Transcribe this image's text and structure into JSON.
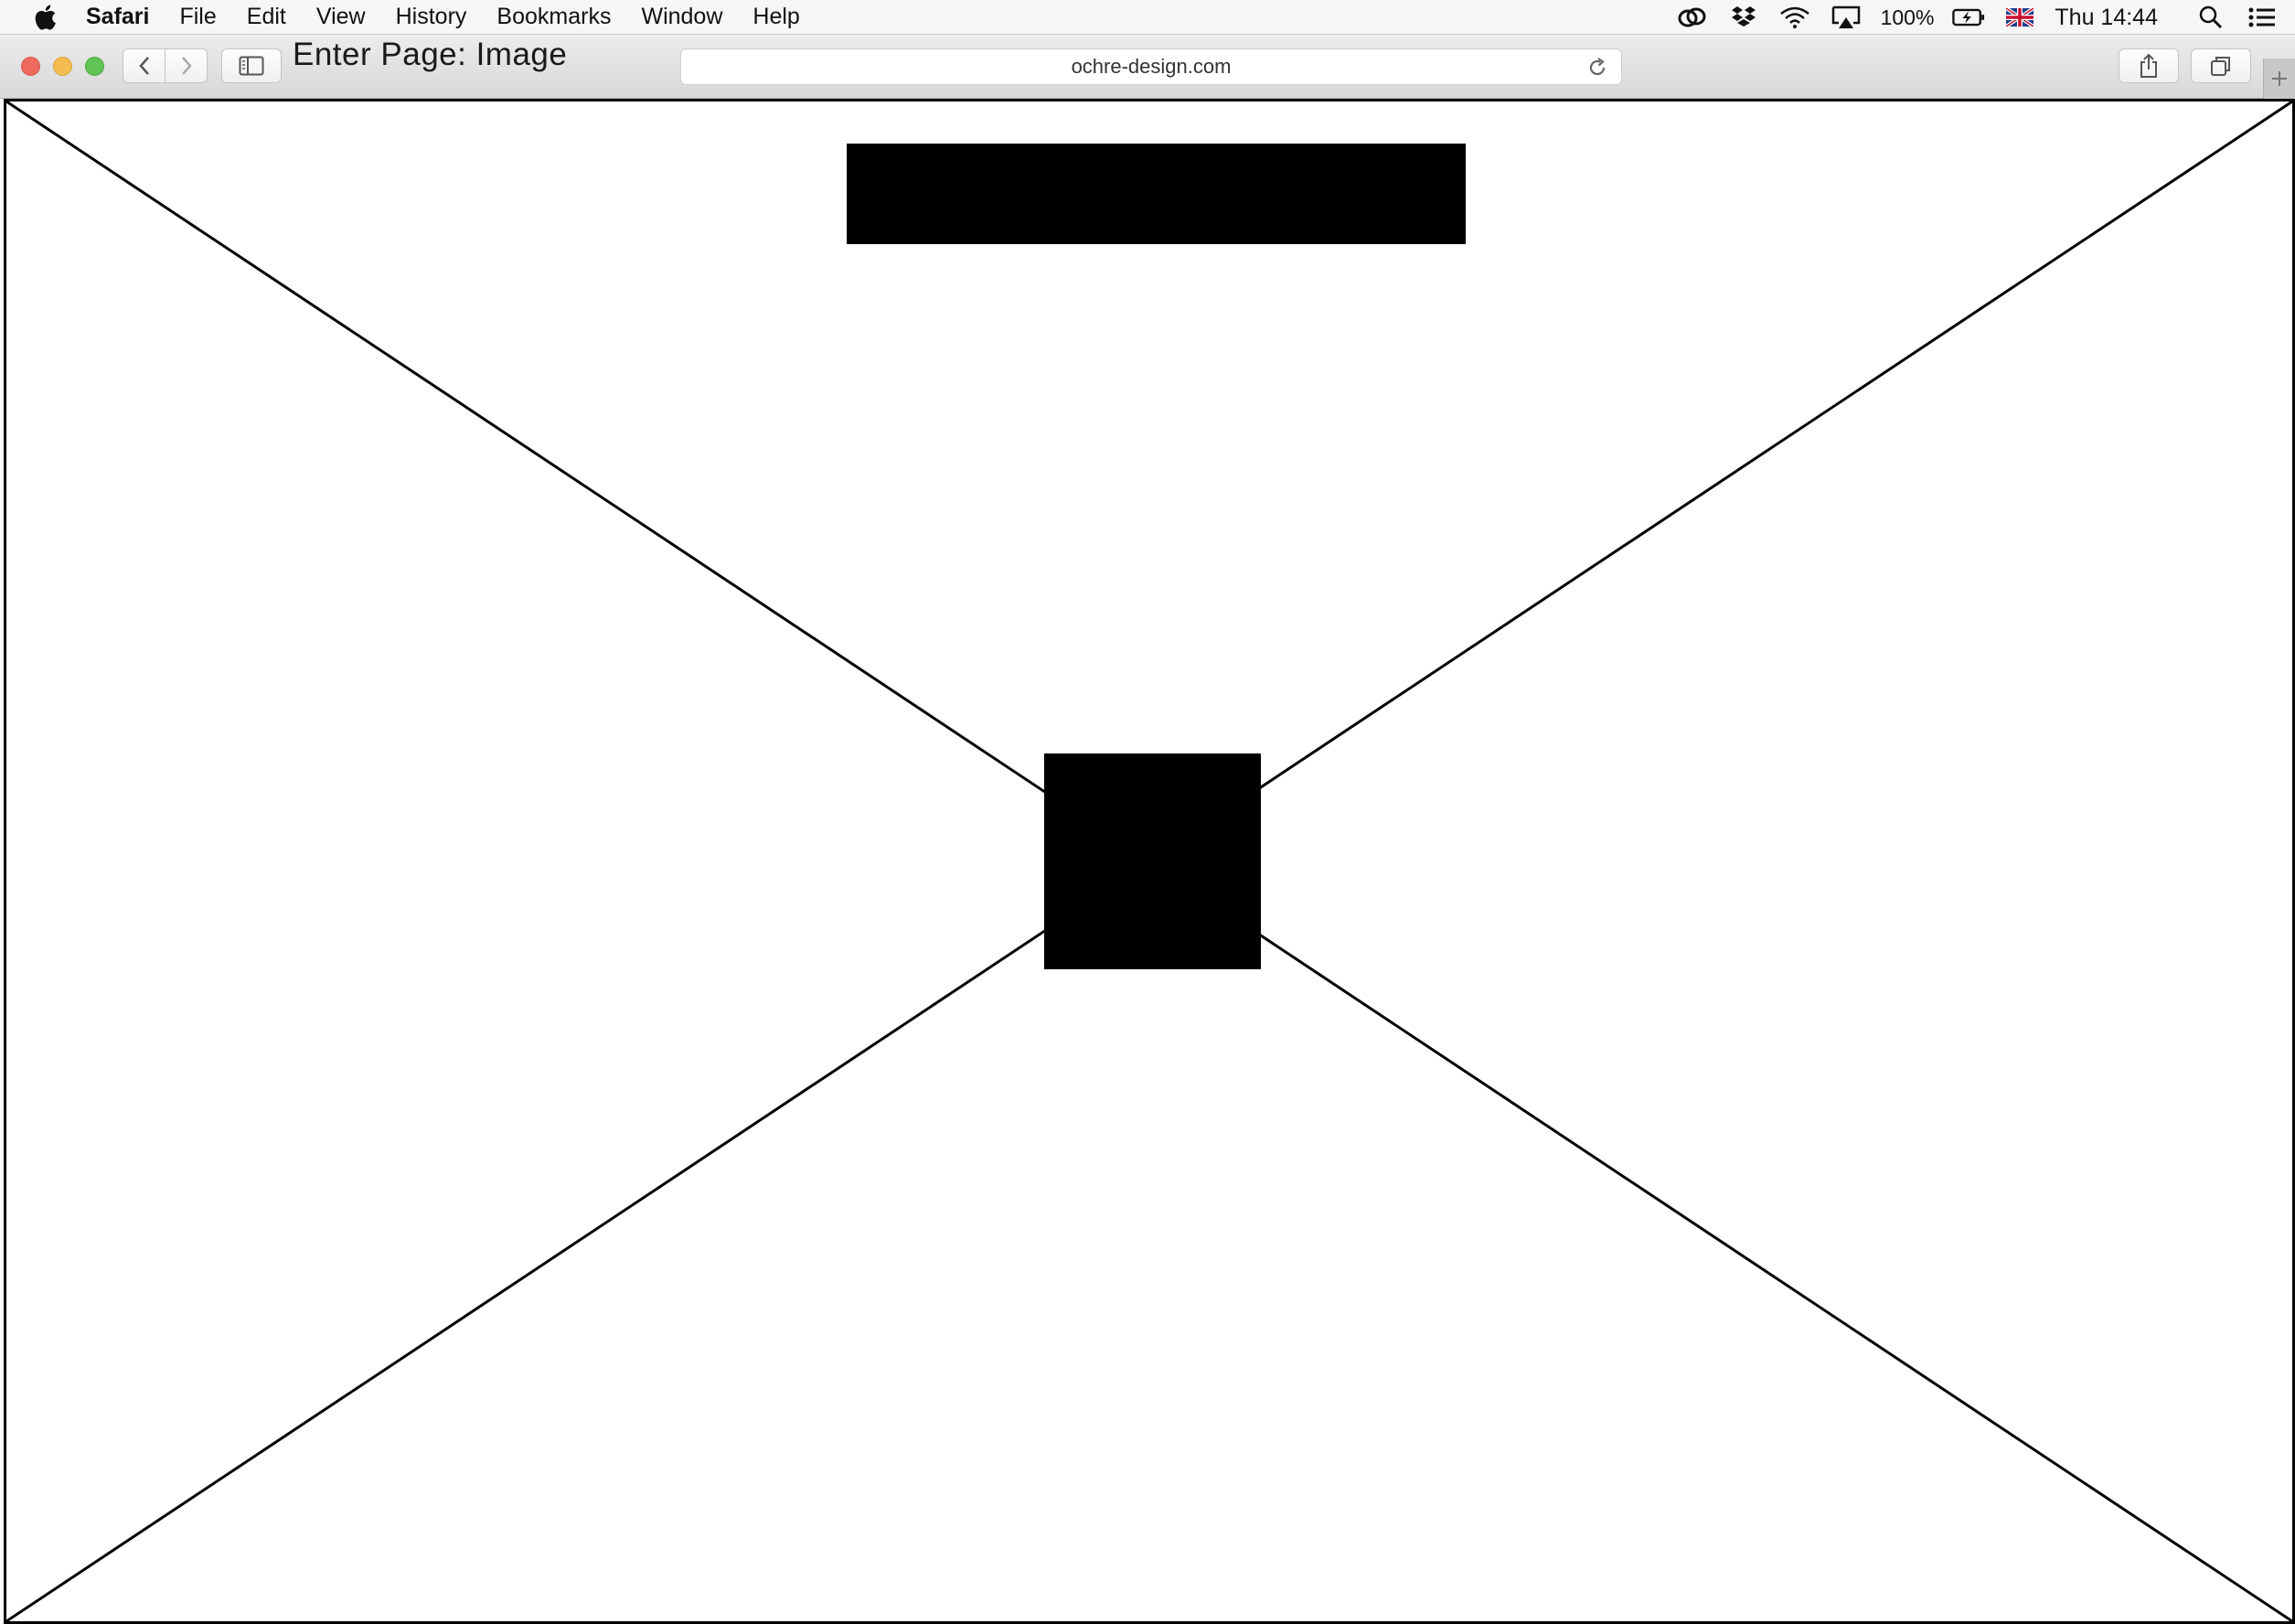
{
  "menubar": {
    "app_name": "Safari",
    "items": [
      "File",
      "Edit",
      "View",
      "History",
      "Bookmarks",
      "Window",
      "Help"
    ],
    "battery": "100%",
    "clock": "Thu 14:44",
    "status_icons": [
      "creative-cloud-icon",
      "dropbox-icon",
      "wifi-icon",
      "airplay-icon",
      "battery-icon",
      "uk-flag-icon",
      "spotlight-icon",
      "notification-center-icon"
    ]
  },
  "toolbar": {
    "page_title": "Enter Page: Image",
    "url": "ochre-design.com"
  },
  "wireframe": {
    "placeholder_type": "image",
    "stroke_color": "#000000",
    "fill_color": "#000000"
  },
  "colors": {
    "close": "#ee6a5f",
    "minimize": "#f5bd4f",
    "maximize": "#61c454"
  }
}
